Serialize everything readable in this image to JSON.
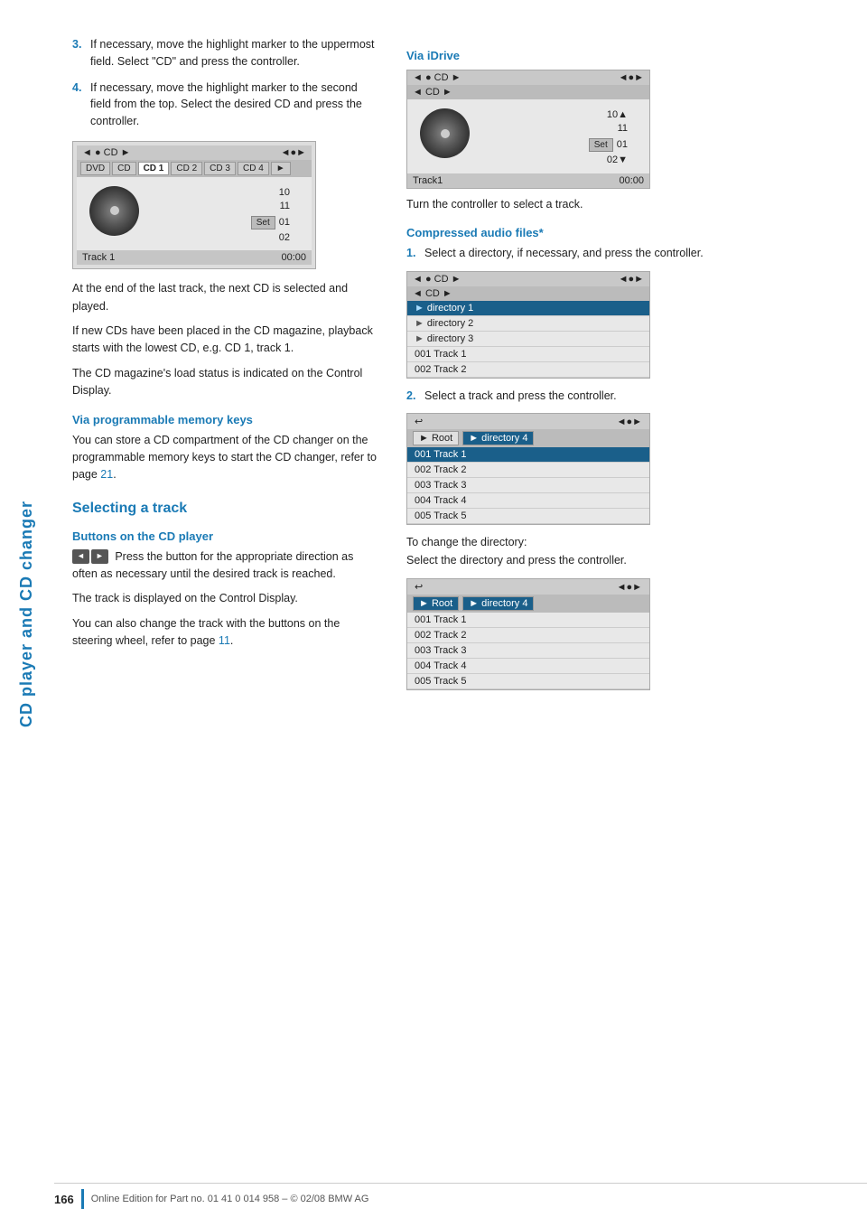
{
  "sidebar": {
    "label": "CD player and CD changer"
  },
  "left": {
    "step3_text": "If necessary, move the highlight marker to the uppermost field. Select \"CD\" and press the controller.",
    "step4_text": "If necessary, move the highlight marker to the second field from the top. Select the desired CD and press the controller.",
    "cd_screen": {
      "top_left": "◄ ● CD ►",
      "top_right": "◄●►",
      "tabs": [
        "DVD",
        "CD",
        "CD 1",
        "CD 2",
        "CD 3",
        "CD 4",
        "►"
      ],
      "tracks": [
        "10",
        "11",
        "01",
        "02"
      ],
      "set_label": "Set",
      "bottom_left": "Track 1",
      "bottom_right": "00:00"
    },
    "para1": "At the end of the last track, the next CD is selected and played.",
    "para2": "If new CDs have been placed in the CD magazine, playback starts with the lowest CD, e.g. CD 1, track 1.",
    "para3": "The CD magazine's load status is indicated on the Control Display.",
    "via_prog_header": "Via programmable memory keys",
    "via_prog_text": "You can store a CD compartment of the CD changer on the programmable memory keys to start the CD changer, refer to page",
    "via_prog_page": "21",
    "selecting_track_header": "Selecting a track",
    "buttons_header": "Buttons on the CD player",
    "buttons_text": "Press the button for the appropriate direction as often as necessary until the desired track is reached.",
    "track_display_text": "The track is displayed on the Control Display.",
    "steering_text": "You can also change the track with the buttons on the steering wheel, refer to page",
    "steering_page": "11"
  },
  "right": {
    "via_idrive_header": "Via iDrive",
    "idrive_screen": {
      "top_left": "◄ ● CD ►",
      "top_right": "◄●►",
      "sub_row": "◄ CD ►",
      "tracks": [
        "10▲",
        "11",
        "01",
        "02▼"
      ],
      "set_label": "Set",
      "bottom_left": "Track1",
      "bottom_right": "00:00"
    },
    "turn_controller_text": "Turn the controller to select a track.",
    "compressed_header": "Compressed audio files*",
    "step1_text": "Select a directory, if necessary, and press the controller.",
    "dir_screen": {
      "top_left": "◄ ● CD ►",
      "top_right": "◄●►",
      "sub_row": "◄ CD ►",
      "rows": [
        {
          "label": "directory 1",
          "arrow": "►",
          "highlight": true
        },
        {
          "label": "directory 2",
          "arrow": "►",
          "highlight": false
        },
        {
          "label": "directory 3",
          "arrow": "►",
          "highlight": false
        },
        {
          "label": "001 Track  1",
          "arrow": "",
          "highlight": false
        },
        {
          "label": "002 Track  2",
          "arrow": "",
          "highlight": false
        }
      ]
    },
    "step2_text": "Select a track and press the controller.",
    "nav_screen1": {
      "breadcrumbs": [
        "Root",
        "directory 4"
      ],
      "rows": [
        {
          "label": "001 Track  1",
          "highlight": true
        },
        {
          "label": "002 Track  2",
          "highlight": false
        },
        {
          "label": "003 Track  3",
          "highlight": false
        },
        {
          "label": "004 Track  4",
          "highlight": false
        },
        {
          "label": "005 Track  5",
          "highlight": false
        }
      ]
    },
    "change_dir_text": "To change the directory:",
    "change_dir_text2": "Select the directory and press the controller.",
    "nav_screen2": {
      "breadcrumbs": [
        "Root",
        "directory 4"
      ],
      "rows": [
        {
          "label": "001 Track  1",
          "highlight": false
        },
        {
          "label": "002 Track  2",
          "highlight": false
        },
        {
          "label": "003 Track  3",
          "highlight": false
        },
        {
          "label": "004 Track  4",
          "highlight": false
        },
        {
          "label": "005 Track  5",
          "highlight": false
        }
      ]
    }
  },
  "footer": {
    "page_number": "166",
    "copyright_text": "Online Edition for Part no. 01 41 0 014 958 – © 02/08 BMW AG"
  }
}
